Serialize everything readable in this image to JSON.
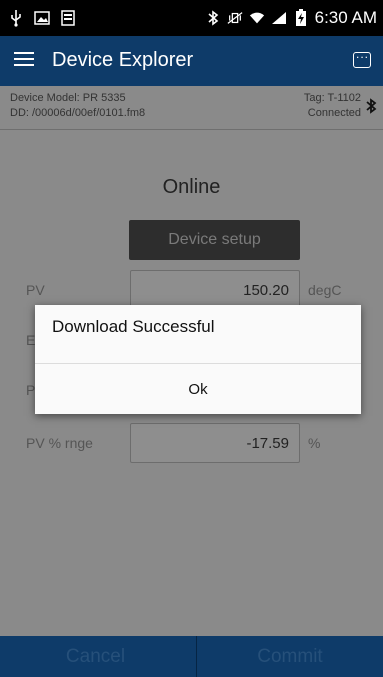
{
  "status_bar": {
    "time": "6:30 AM",
    "left_icons": [
      "usb-icon",
      "image-icon",
      "document-icon"
    ],
    "right_icons": [
      "bluetooth-icon",
      "vibrate-mute-icon",
      "wifi-icon",
      "signal-icon",
      "battery-charging-icon"
    ]
  },
  "app_bar": {
    "title": "Device Explorer",
    "menu_icon": "hamburger-menu-icon",
    "action_icon": "chat-icon"
  },
  "device_info": {
    "model": "Device Model:  PR 5335",
    "dd": "DD:  /00006d/00ef/0101.fm8",
    "tag": "Tag:  T-1102",
    "status": "Connected"
  },
  "main": {
    "status_heading": "Online",
    "setup_button": "Device setup",
    "rows": [
      {
        "label": "PV",
        "value": "150.20",
        "unit": "degC"
      },
      {
        "label": "E",
        "value": "",
        "unit": ""
      },
      {
        "label": "P",
        "value": "",
        "unit": ""
      },
      {
        "label": "PV % rnge",
        "value": "-17.59",
        "unit": "%"
      }
    ]
  },
  "bottom_bar": {
    "cancel": "Cancel",
    "commit": "Commit"
  },
  "dialog": {
    "title": "Download Successful",
    "ok": "Ok"
  }
}
